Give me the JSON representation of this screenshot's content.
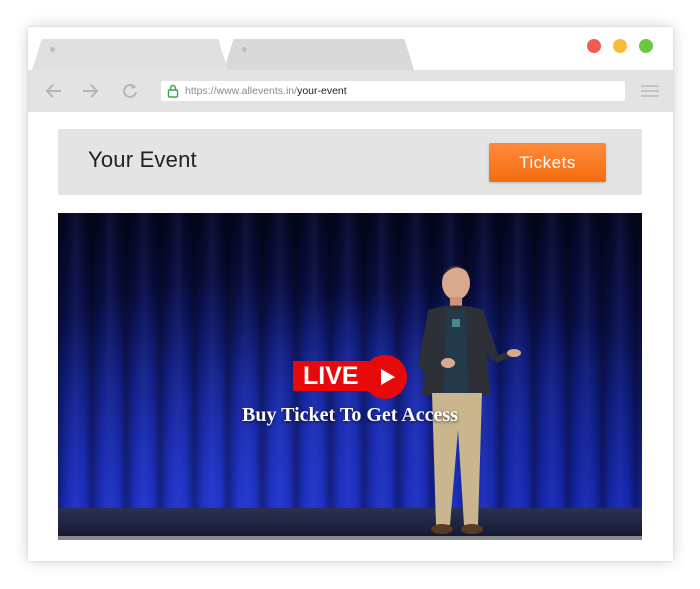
{
  "browser": {
    "url_prefix": "https://www.allevents.in/",
    "url_path": "your-event",
    "window_controls": {
      "close_color": "#f35b4d",
      "minimize_color": "#f5bc3c",
      "maximize_color": "#6cc842"
    },
    "icons": {
      "back": "arrow-left-icon",
      "forward": "arrow-right-icon",
      "reload": "reload-icon",
      "secure": "lock-icon",
      "menu": "hamburger-menu-icon"
    }
  },
  "event": {
    "title": "Your Event",
    "tickets_label": "Tickets",
    "accent_color": "#f47a1f"
  },
  "video": {
    "live_label": "LIVE",
    "access_text": "Buy Ticket To Get Access",
    "live_color": "#e80a0a",
    "play_icon": "play-icon"
  }
}
